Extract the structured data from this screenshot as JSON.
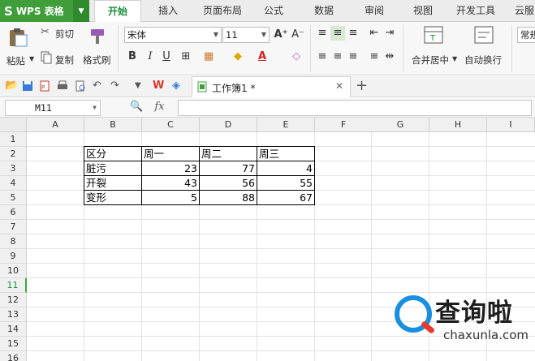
{
  "app": {
    "logo_letter": "S",
    "logo_text": "WPS 表格"
  },
  "menu_tabs": [
    {
      "label": "开始",
      "active": true
    },
    {
      "label": "插入"
    },
    {
      "label": "页面布局"
    },
    {
      "label": "公式"
    },
    {
      "label": "数据"
    },
    {
      "label": "审阅"
    },
    {
      "label": "视图"
    },
    {
      "label": "开发工具"
    },
    {
      "label": "云服"
    }
  ],
  "ribbon": {
    "paste": "粘贴",
    "cut": "剪切",
    "copy": "复制",
    "format_painter": "格式刷",
    "font_name": "宋体",
    "font_size": "11",
    "bold": "B",
    "italic": "I",
    "underline": "U",
    "merge_center": "合并居中",
    "wrap_text": "自动换行",
    "number_format": "常规",
    "grow_font": "A⁺",
    "shrink_font": "A⁻",
    "font_color": "A"
  },
  "document": {
    "tab_name": "工作簿1 *"
  },
  "formula_bar": {
    "cell_ref": "M11",
    "fx": "fx",
    "content": ""
  },
  "columns": [
    "A",
    "B",
    "C",
    "D",
    "E",
    "F",
    "G",
    "H",
    "I"
  ],
  "rows": [
    "1",
    "2",
    "3",
    "4",
    "5",
    "6",
    "7",
    "8",
    "9",
    "10",
    "11",
    "12",
    "13",
    "14",
    "15",
    "16"
  ],
  "selected_row": "11",
  "table": {
    "header": [
      "区分",
      "周一",
      "周二",
      "周三"
    ],
    "rows": [
      {
        "label": "脏污",
        "values": [
          "23",
          "77",
          "4"
        ]
      },
      {
        "label": "开裂",
        "values": [
          "43",
          "56",
          "55"
        ]
      },
      {
        "label": "变形",
        "values": [
          "5",
          "88",
          "67"
        ]
      }
    ]
  },
  "watermark": {
    "chinese": "查询啦",
    "url": "chaxunla.com"
  },
  "colors": {
    "brand_green": "#3f9d3a",
    "active_tab_text": "#1c8f3c",
    "watermark_blue": "#1a8fe0",
    "watermark_red": "#e53b2c"
  }
}
